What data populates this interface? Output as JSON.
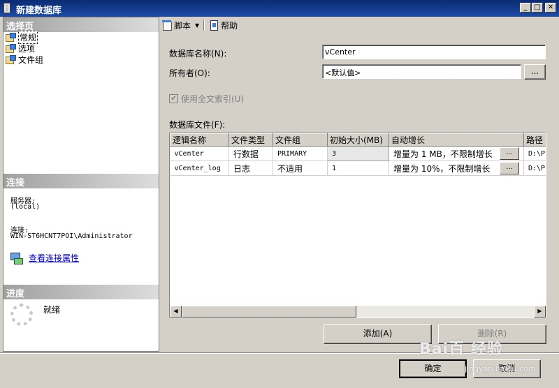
{
  "window": {
    "title": "新建数据库"
  },
  "sidebar": {
    "select_page_header": "选择页",
    "pages": [
      {
        "label": "常规",
        "selected": true
      },
      {
        "label": "选项",
        "selected": false
      },
      {
        "label": "文件组",
        "selected": false
      }
    ],
    "connection_header": "连接",
    "server_label": "服务器:",
    "server_value": "(local)",
    "connection_label": "连接:",
    "connection_value": "WIN-ST6HCNT7POI\\Administrator",
    "view_connection_link": "查看连接属性",
    "progress_header": "进度",
    "progress_status": "就绪"
  },
  "toolbar": {
    "script_label": "脚本",
    "help_label": "帮助"
  },
  "form": {
    "db_name_label": "数据库名称(N):",
    "db_name_value": "vCenter",
    "owner_label": "所有者(O):",
    "owner_value": "<默认值>",
    "owner_browse": "...",
    "fulltext_label": "使用全文索引(U)",
    "db_files_label": "数据库文件(F):"
  },
  "table": {
    "columns": [
      "逻辑名称",
      "文件类型",
      "文件组",
      "初始大小(MB)",
      "自动增长",
      "路径"
    ],
    "rows": [
      {
        "name": "vCenter",
        "type": "行数据",
        "group": "PRIMARY",
        "size": "3",
        "growth": "增量为 1 MB，不限制增长",
        "growth_btn": "...",
        "path": "D:\\Pr"
      },
      {
        "name": "vCenter_log",
        "type": "日志",
        "group": "不适用",
        "size": "1",
        "growth": "增量为 10%，不限制增长",
        "growth_btn": "...",
        "path": "D:\\Pr"
      }
    ]
  },
  "buttons": {
    "add": "添加(A)",
    "remove": "删除(R)",
    "ok": "确定",
    "cancel": "取消"
  },
  "watermark": {
    "logo": "Bai百 经验",
    "url": "jingyan.baidu.com"
  }
}
